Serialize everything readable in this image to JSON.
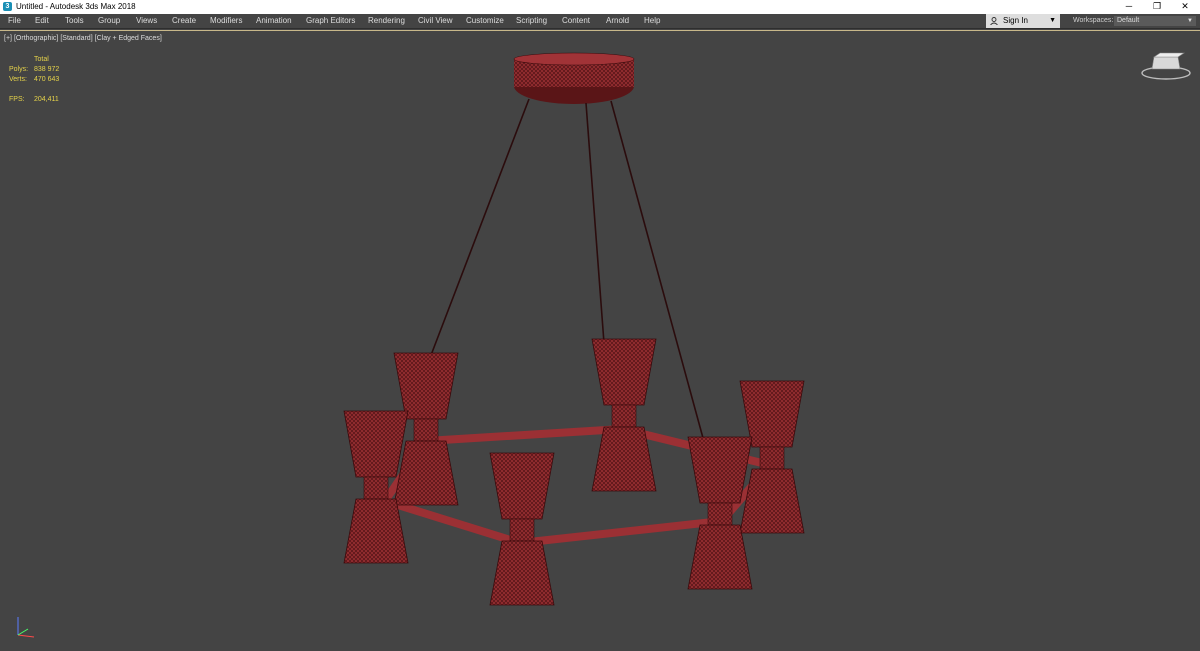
{
  "window": {
    "title": "Untitled - Autodesk 3ds Max 2018",
    "controls": {
      "minimize": "─",
      "restore": "❐",
      "close": "✕"
    }
  },
  "menu": [
    "File",
    "Edit",
    "Tools",
    "Group",
    "Views",
    "Create",
    "Modifiers",
    "Animation",
    "Graph Editors",
    "Rendering",
    "Civil View",
    "Customize",
    "Scripting",
    "Content",
    "Arnold",
    "Help"
  ],
  "account": {
    "sign_in_label": "Sign In",
    "arrow": "▼"
  },
  "workspace": {
    "label": "Workspaces:",
    "value": "Default",
    "arrow": "▼"
  },
  "viewport": {
    "label_parts": [
      "[+]",
      "[Orthographic]",
      "[Standard]",
      "[Clay + Edged Faces]"
    ],
    "stats": {
      "header": "Total",
      "polys_label": "Polys:",
      "polys_value": "838 972",
      "verts_label": "Verts:",
      "verts_value": "470 643",
      "fps_label": "FPS:",
      "fps_value": "204,411"
    }
  },
  "icons": {
    "app": "3ds-max-logo-icon",
    "user": "user-icon",
    "viewcube": "viewcube-icon",
    "axis": "axis-gizmo-icon"
  },
  "colors": {
    "viewport_bg": "#444444",
    "model_red": "#8a2a2c",
    "wire": "#3a0a0c",
    "stats_yellow": "#e6d34a",
    "viewport_border": "#c8b88a"
  }
}
